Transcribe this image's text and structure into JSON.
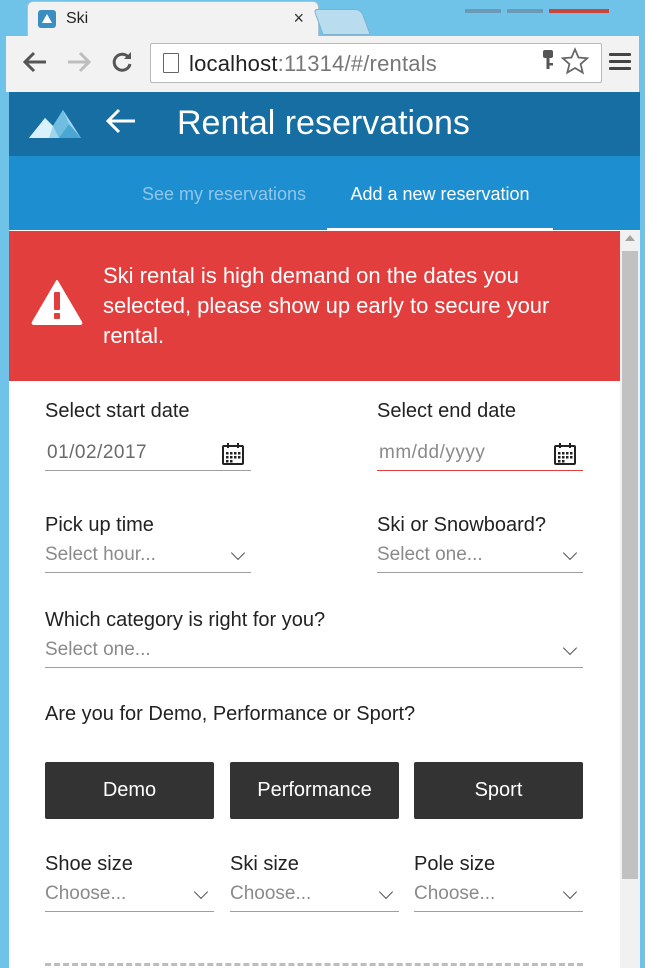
{
  "browser": {
    "tab_title": "Ski",
    "tab_close": "×",
    "url_host": "localhost",
    "url_rest": ":11314/#/rentals"
  },
  "app": {
    "title": "Rental reservations",
    "tabs": [
      {
        "label": "See my reservations",
        "active": false
      },
      {
        "label": "Add a new reservation",
        "active": true
      }
    ],
    "alert": {
      "text": "Ski rental is high demand on the dates you selected, please show up early to secure your rental.",
      "color": "#e33e3e"
    },
    "form": {
      "start_date": {
        "label": "Select start date",
        "value": "01/02/2017"
      },
      "end_date": {
        "label": "Select end date",
        "placeholder": "mm/dd/yyyy"
      },
      "pickup_time": {
        "label": "Pick up time",
        "placeholder": "Select hour..."
      },
      "ski_or_snowboard": {
        "label": "Ski or Snowboard?",
        "placeholder": "Select one..."
      },
      "category": {
        "label": "Which category is right for you?",
        "placeholder": "Select one..."
      },
      "level": {
        "label": "Are you for Demo, Performance or Sport?",
        "buttons": [
          "Demo",
          "Performance",
          "Sport"
        ]
      },
      "shoe_size": {
        "label": "Shoe size",
        "placeholder": "Choose..."
      },
      "ski_size": {
        "label": "Ski size",
        "placeholder": "Choose..."
      },
      "pole_size": {
        "label": "Pole size",
        "placeholder": "Choose..."
      }
    }
  },
  "colors": {
    "header": "#176ea2",
    "tabs_bar": "#1d8fd0",
    "button": "#333333"
  }
}
